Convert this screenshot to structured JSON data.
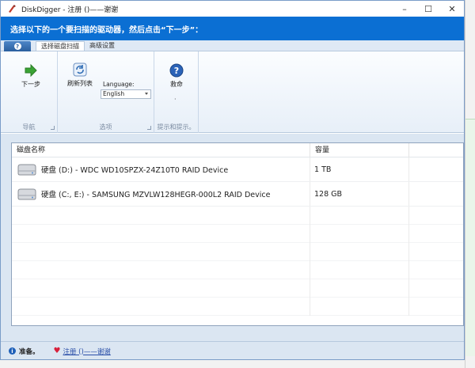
{
  "window": {
    "title": "DiskDigger - 注册 ()——谢谢",
    "controls": {
      "minimize": "–",
      "maximize": "☐",
      "close": "✕"
    }
  },
  "header": {
    "instruction": "选择以下的一个要扫描的驱动器，然后点击“下一步”："
  },
  "ribbon_tabs": [
    {
      "label": "选择磁盘扫描",
      "active": true
    },
    {
      "label": "高级设置",
      "active": false
    }
  ],
  "app_menu_icon": "help-orb-icon",
  "ribbon": {
    "groups": [
      {
        "label": "导航",
        "buttons": [
          {
            "label": "下一步",
            "icon": "green-arrow-right-icon"
          }
        ]
      },
      {
        "label": "选项",
        "buttons": [
          {
            "label": "刷新列表",
            "icon": "refresh-icon"
          }
        ],
        "language": {
          "label": "Language:",
          "value": "English"
        }
      },
      {
        "label": "提示和提示。",
        "buttons": [
          {
            "label": "救命",
            "icon": "help-question-icon"
          }
        ],
        "extra": "·"
      }
    ]
  },
  "drive_list": {
    "columns": [
      "磁盘名称",
      "容量"
    ],
    "rows": [
      {
        "name": "硬盘 (D:) - WDC WD10SPZX-24Z10T0 RAID Device",
        "capacity": "1 TB",
        "icon": "hard-drive-icon"
      },
      {
        "name": "硬盘 (C:, E:) - SAMSUNG MZVLW128HEGR-000L2 RAID Device",
        "capacity": "128 GB",
        "icon": "hard-drive-icon"
      }
    ]
  },
  "status": {
    "ready": "准备。",
    "register_link": "注册 ()——谢谢",
    "info_icon": "info-icon",
    "heart_icon": "heart-icon"
  },
  "colors": {
    "header_blue": "#0b6fd3",
    "ribbon_bg": "#e7eff8",
    "status_bg": "#dbe6f2"
  }
}
